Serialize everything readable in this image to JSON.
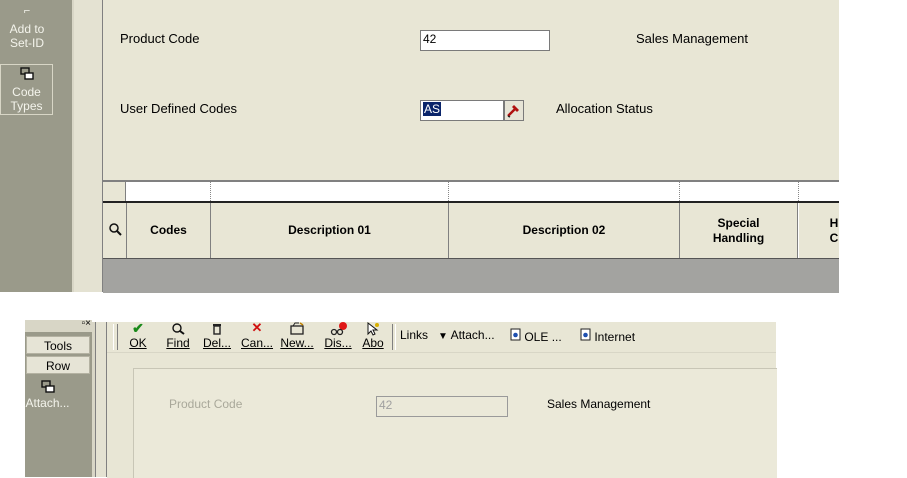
{
  "top_window": {
    "sidebar": {
      "add_to_setid": "Add to Set-ID",
      "code_types": "Code Types"
    },
    "form": {
      "product_code_label": "Product Code",
      "product_code_value": "42",
      "product_code_desc": "Sales Management",
      "udc_label": "User Defined Codes",
      "udc_value": "AS",
      "udc_desc": "Allocation Status"
    },
    "grid": {
      "columns": [
        "Codes",
        "Description 01",
        "Description 02",
        "Special Handling",
        "H C"
      ]
    }
  },
  "bottom_window": {
    "sidebar": {
      "tools": "Tools",
      "row": "Row",
      "attach": "Attach..."
    },
    "toolbar": {
      "ok": "OK",
      "find": "Find",
      "delete": "Del...",
      "cancel": "Can...",
      "new": "New...",
      "display": "Dis...",
      "about": "Abo",
      "links": "Links",
      "attach": "Attach...",
      "ole": "OLE ...",
      "internet": "Internet"
    },
    "form": {
      "product_code_label": "Product Code",
      "product_code_value": "42",
      "product_code_desc": "Sales Management"
    }
  },
  "colors": {
    "panel": "#e8e6d5",
    "sidebar": "#9a9a8a",
    "selection": "#0a246a"
  }
}
